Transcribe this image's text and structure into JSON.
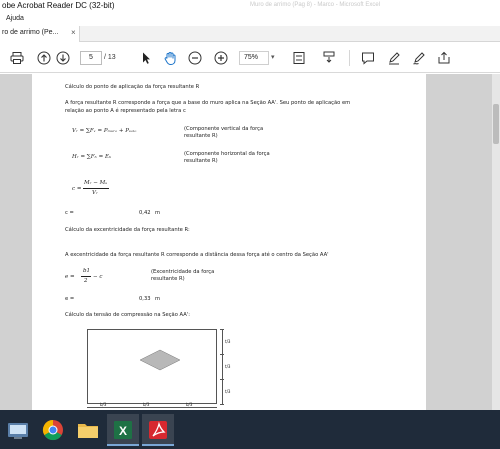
{
  "window": {
    "title": "obe Acrobat Reader DC (32-bit)",
    "background_title": "Muro de arrimo (Pag 8) - Marco - Microsoft Excel"
  },
  "menu": {
    "items": [
      "Ajuda"
    ]
  },
  "tab": {
    "label": "ro de arrimo (Pe...",
    "close": "×"
  },
  "toolbar": {
    "page_current": "5",
    "page_total": "/ 13",
    "zoom": "75%",
    "zoom_caret": "▾",
    "icons": [
      "print-icon",
      "page-up-icon",
      "page-down-icon",
      "select-cursor-icon",
      "hand-tool-icon",
      "zoom-out-icon",
      "zoom-in-icon",
      "fit-page-icon",
      "scroll-mode-icon",
      "comment-icon",
      "highlight-icon",
      "sign-icon",
      "share-icon"
    ]
  },
  "document": {
    "heading1": "Cálculo do ponto de aplicação da força resultante R",
    "para1_line1": "A força resultante R corresponde a força que a base do muro aplica na Seção AA'. Seu ponto de aplicação em",
    "para1_line2": "relação ao ponto A é representado pela letra c",
    "eq_v": "Vᵣ = ∑Fᵥ = Pₘᵤᵣₒ + Pₛₒₗₒ",
    "eq_v_note1": "(Componente vertical da força",
    "eq_v_note2": "resultante R)",
    "eq_h": "Hᵣ = ∑Fₕ = Eₕ",
    "eq_h_note1": "(Componente horizontal da força",
    "eq_h_note2": "resultante R)",
    "eq_c_left": "c =",
    "eq_c_num": "Mᵣ − Mₛ",
    "eq_c_den": "Vᵣ",
    "c_label": "c =",
    "c_value": "0,42",
    "c_unit": "m",
    "heading2": "Cálculo da excentricidade da força resultante R:",
    "para2": "A excentricidade da força resultante R corresponde a distância dessa força até o centro da Seção AA'",
    "eq_e_left": "e =",
    "eq_e_num": "b1",
    "eq_e_den": "2",
    "eq_e_rest": "− c",
    "eq_e_note1": "(Excentricidade da força",
    "eq_e_note2": "resultante R)",
    "e_label": "e =",
    "e_value": "0,33",
    "e_unit": "m",
    "heading3": "Cálculo da tensão de compressão na Seção AA':",
    "dim_right_top": "t/3",
    "dim_right_mid": "t/3",
    "dim_right_bot": "t/3",
    "dim_bottom_1": "b/3",
    "dim_bottom_2": "b/3",
    "dim_bottom_3": "b/3"
  },
  "taskbar": {
    "apps": [
      "file-explorer-icon",
      "chrome-icon",
      "folder-icon",
      "excel-icon",
      "acrobat-icon"
    ],
    "excel_letter": "X"
  }
}
